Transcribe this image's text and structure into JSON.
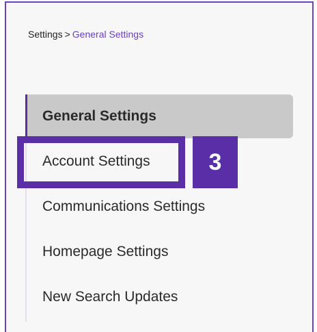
{
  "breadcrumb": {
    "root": "Settings",
    "separator": ">",
    "current": "General Settings"
  },
  "nav": {
    "items": [
      {
        "label": "General Settings",
        "active": true
      },
      {
        "label": "Account Settings",
        "active": false
      },
      {
        "label": "Communications Settings",
        "active": false
      },
      {
        "label": "Homepage Settings",
        "active": false
      },
      {
        "label": "New Search Updates",
        "active": false
      }
    ]
  },
  "annotation": {
    "step_number": "3"
  },
  "colors": {
    "accent": "#5a2ea6",
    "link": "#6b3fc0",
    "active_bg": "#c9c9c9",
    "panel_bg": "#f7f7f7"
  }
}
